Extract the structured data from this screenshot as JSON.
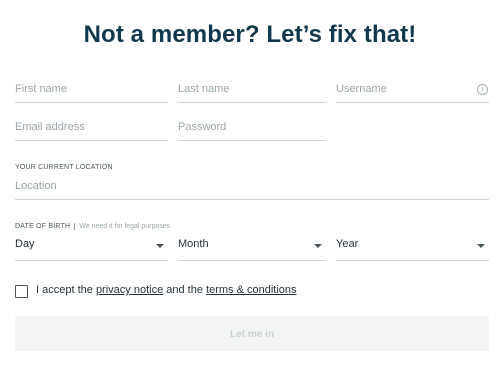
{
  "heading": "Not a member? Let’s fix that!",
  "fields": {
    "first_name": {
      "placeholder": "First name",
      "value": ""
    },
    "last_name": {
      "placeholder": "Last name",
      "value": ""
    },
    "username": {
      "placeholder": "Username",
      "value": "",
      "icon": "info-icon"
    },
    "email": {
      "placeholder": "Email address",
      "value": ""
    },
    "password": {
      "placeholder": "Password",
      "value": ""
    },
    "location": {
      "placeholder": "Location",
      "value": ""
    }
  },
  "location_label": "YOUR CURRENT LOCATION",
  "dob": {
    "label": "DATE OF BIRTH",
    "note": "We need it for legal purposes",
    "day": "Day",
    "month": "Month",
    "year": "Year"
  },
  "consent": {
    "prefix": "I accept the ",
    "privacy_link": "privacy notice",
    "middle": " and the ",
    "terms_link": "terms & conditions",
    "checked": false
  },
  "submit": {
    "label": "Let me in",
    "disabled": true
  },
  "colors": {
    "heading": "#12384d",
    "text": "#24343b",
    "placeholder": "#9aa5aa",
    "divider": "#cfd6d9",
    "button_bg": "#f3f4f4",
    "button_text": "#cdd2d4"
  }
}
